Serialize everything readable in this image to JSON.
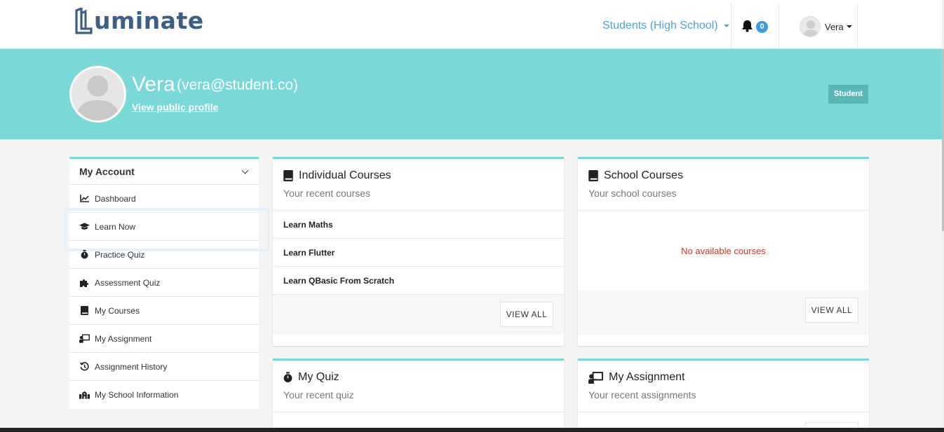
{
  "header": {
    "brand": "uminate",
    "role_selector": "Students (High School)",
    "notifications_count": "0",
    "user_name": "Vera"
  },
  "profile": {
    "name": "Vera",
    "email": "(vera@student.co)",
    "public_profile_link": "View public profile",
    "role_tag": "Student"
  },
  "sidebar": {
    "heading": "My Account",
    "items": [
      {
        "label": "Dashboard",
        "icon": "chart-line-icon"
      },
      {
        "label": "Learn Now",
        "icon": "graduation-cap-icon"
      },
      {
        "label": "Practice Quiz",
        "icon": "stopwatch-icon"
      },
      {
        "label": "Assessment Quiz",
        "icon": "puzzle-icon"
      },
      {
        "label": "My Courses",
        "icon": "book-icon"
      },
      {
        "label": "My Assignment",
        "icon": "chalkboard-teacher-icon"
      },
      {
        "label": "Assignment History",
        "icon": "history-icon"
      },
      {
        "label": "My School Information",
        "icon": "school-icon"
      }
    ]
  },
  "individual_courses": {
    "title": "Individual Courses",
    "subtitle": "Your recent courses",
    "courses": [
      "Learn Maths",
      "Learn Flutter",
      "Learn QBasic From Scratch"
    ],
    "view_all": "VIEW ALL"
  },
  "school_courses": {
    "title": "School Courses",
    "subtitle": "Your school courses",
    "empty_message": "No available courses",
    "view_all": "VIEW ALL"
  },
  "my_quiz": {
    "title": "My Quiz",
    "subtitle": "Your recent quiz"
  },
  "my_assignment": {
    "title": "My Assignment",
    "subtitle": "Your recent assignments"
  },
  "colors": {
    "accent": "#7ad8d6",
    "brand": "#3b5f86",
    "link": "#4aa3df",
    "badge": "#3a9ce0",
    "empty_text": "#c0392b"
  }
}
